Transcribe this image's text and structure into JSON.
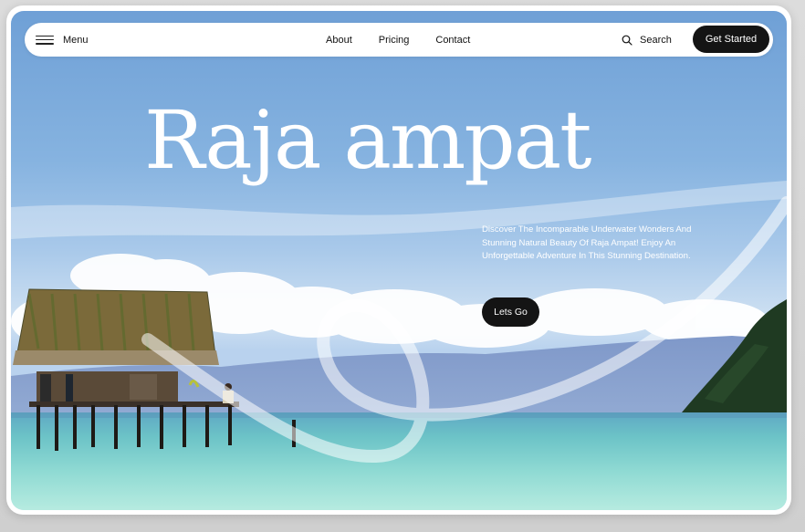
{
  "nav": {
    "menu_label": "Menu",
    "links": [
      "About",
      "Pricing",
      "Contact"
    ],
    "search_label": "Search",
    "cta_label": "Get Started"
  },
  "hero": {
    "title": "Raja ampat",
    "description": "Discover The Incomparable Underwater Wonders And Stunning Natural Beauty Of Raja Ampat! Enjoy An Unforgettable Adventure In This Stunning Destination.",
    "button_label": "Lets Go"
  },
  "icons": {
    "menu": "hamburger-icon",
    "search": "search-icon"
  },
  "colors": {
    "sky": "#86b3e0",
    "sea": "#7fd0cc",
    "button": "#141414",
    "text_light": "#ffffff"
  }
}
